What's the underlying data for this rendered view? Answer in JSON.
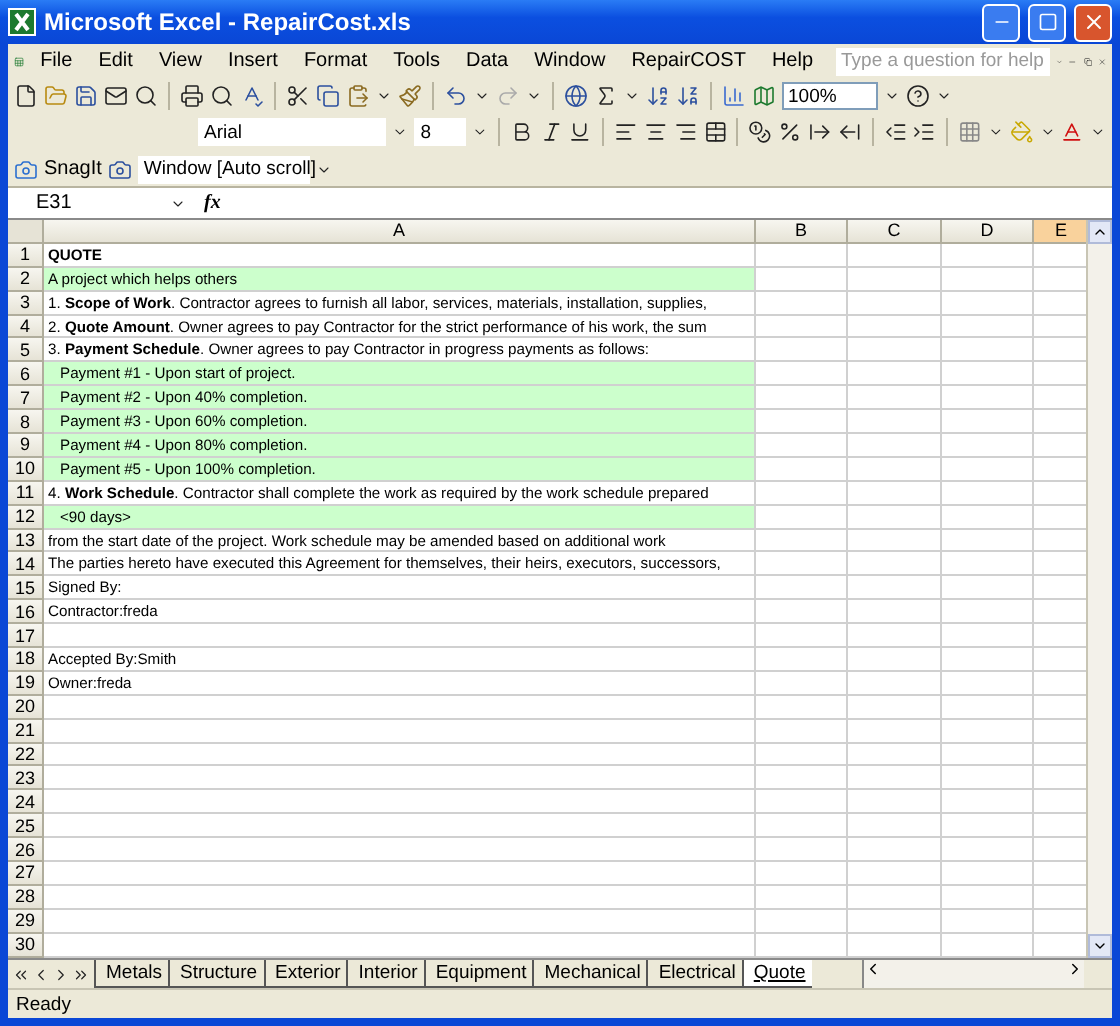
{
  "window": {
    "title": "Microsoft Excel - RepairCost.xls"
  },
  "menu": [
    {
      "label": "File"
    },
    {
      "label": "Edit"
    },
    {
      "label": "View"
    },
    {
      "label": "Insert"
    },
    {
      "label": "Format"
    },
    {
      "label": "Tools"
    },
    {
      "label": "Data"
    },
    {
      "label": "Window"
    },
    {
      "label": "RepairCOST"
    },
    {
      "label": "Help"
    }
  ],
  "help_search": {
    "placeholder": "Type a question for help"
  },
  "standard_toolbar": {
    "zoom": "100%"
  },
  "formatting_toolbar": {
    "font": "Arial",
    "size": "8"
  },
  "snagit_toolbar": {
    "label": "SnagIt",
    "capture_mode": "Window [Auto scroll]"
  },
  "formula_bar": {
    "name_box": "E31",
    "function_label": "fx"
  },
  "columns": [
    {
      "label": "A",
      "selected": false
    },
    {
      "label": "B",
      "selected": false
    },
    {
      "label": "C",
      "selected": false
    },
    {
      "label": "D",
      "selected": false
    },
    {
      "label": "E",
      "selected": true
    }
  ],
  "rows": [
    {
      "number": "1",
      "text": "QUOTE",
      "bold": true,
      "fill": false,
      "indent": false
    },
    {
      "number": "2",
      "text": "A project which helps others",
      "bold": false,
      "fill": true,
      "indent": false
    },
    {
      "number": "3",
      "text": "1. **Scope of Work**. Contractor agrees to furnish all labor, services, materials, installation, supplies,",
      "bold": false,
      "fill": false,
      "indent": false
    },
    {
      "number": "4",
      "text": "2. **Quote Amount**. Owner agrees to pay Contractor for the strict performance of his work, the sum",
      "bold": false,
      "fill": false,
      "indent": false
    },
    {
      "number": "5",
      "text": "3. **Payment Schedule**. Owner agrees to pay Contractor in progress payments as follows:",
      "bold": false,
      "fill": false,
      "indent": false
    },
    {
      "number": "6",
      "text": "Payment #1 - Upon start of project.",
      "bold": false,
      "fill": true,
      "indent": true
    },
    {
      "number": "7",
      "text": "Payment #2 - Upon 40% completion.",
      "bold": false,
      "fill": true,
      "indent": true
    },
    {
      "number": "8",
      "text": "Payment #3 - Upon 60% completion.",
      "bold": false,
      "fill": true,
      "indent": true
    },
    {
      "number": "9",
      "text": "Payment #4 - Upon 80% completion.",
      "bold": false,
      "fill": true,
      "indent": true
    },
    {
      "number": "10",
      "text": "Payment #5 - Upon 100% completion.",
      "bold": false,
      "fill": true,
      "indent": true
    },
    {
      "number": "11",
      "text": "4. **Work Schedule**. Contractor shall complete the work as required by the work schedule prepared",
      "bold": false,
      "fill": false,
      "indent": false
    },
    {
      "number": "12",
      "text": "<90 days>",
      "bold": false,
      "fill": true,
      "indent": true
    },
    {
      "number": "13",
      "text": "from the start date of the project. Work schedule may be amended based on additional work",
      "bold": false,
      "fill": false,
      "indent": false
    },
    {
      "number": "14",
      "text": "The parties hereto have executed this Agreement for themselves, their heirs, executors, successors,",
      "bold": false,
      "fill": false,
      "indent": false
    },
    {
      "number": "15",
      "text": "Signed By:",
      "bold": false,
      "fill": false,
      "indent": false
    },
    {
      "number": "16",
      "text": "Contractor:freda",
      "bold": false,
      "fill": false,
      "indent": false
    },
    {
      "number": "17",
      "fill": false
    },
    {
      "number": "18",
      "text": "Accepted By:Smith",
      "bold": false,
      "fill": false,
      "indent": false
    },
    {
      "number": "19",
      "text": "Owner:freda",
      "bold": false,
      "fill": false,
      "indent": false
    },
    {
      "number": "20",
      "fill": false
    },
    {
      "number": "21",
      "fill": false
    },
    {
      "number": "22",
      "fill": false
    },
    {
      "number": "23",
      "fill": false
    },
    {
      "number": "24",
      "fill": false
    },
    {
      "number": "25",
      "fill": false
    },
    {
      "number": "26",
      "fill": false
    },
    {
      "number": "27",
      "fill": false
    },
    {
      "number": "28",
      "fill": false
    },
    {
      "number": "29",
      "fill": false
    },
    {
      "number": "30",
      "fill": false
    }
  ],
  "sheet_tabs": [
    {
      "label": "Metals",
      "selected": false
    },
    {
      "label": "Structure",
      "selected": false
    },
    {
      "label": "Exterior",
      "selected": false
    },
    {
      "label": "Interior",
      "selected": false
    },
    {
      "label": "Equipment",
      "selected": false
    },
    {
      "label": "Mechanical",
      "selected": false
    },
    {
      "label": "Electrical",
      "selected": false
    },
    {
      "label": "Quote",
      "selected": true
    }
  ],
  "status_bar": {
    "text": "Ready"
  }
}
